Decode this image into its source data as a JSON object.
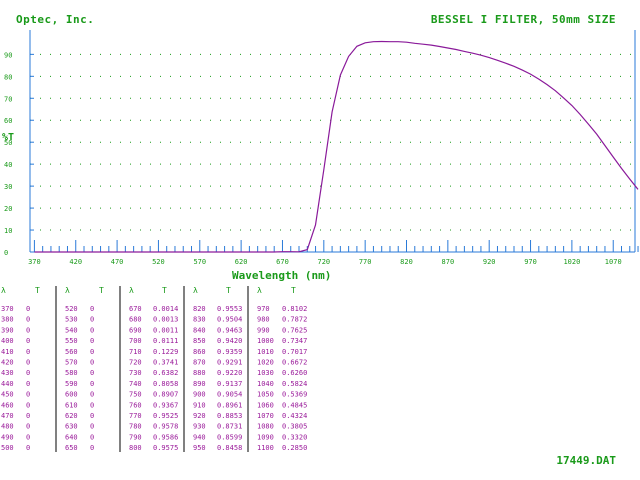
{
  "header": {
    "company": "Optec, Inc.",
    "title": "BESSEL I FILTER, 50mm SIZE"
  },
  "footer": {
    "filename": "17449.DAT"
  },
  "colors": {
    "green": "#1a9a1a",
    "curve": "#8a1a9a",
    "axis": "#2a7ad8",
    "value": "#9a1a9a",
    "grid": "#1a9a1a"
  },
  "chart_data": {
    "type": "line",
    "title": "BESSEL I FILTER, 50mm SIZE",
    "xlabel": "Wavelength (nm)",
    "ylabel": "%T",
    "xlim": [
      370,
      1100
    ],
    "ylim": [
      0,
      100
    ],
    "xticks": [
      370,
      420,
      470,
      520,
      570,
      620,
      670,
      720,
      770,
      820,
      870,
      920,
      970,
      1020,
      1070
    ],
    "yticks": [
      0,
      10,
      20,
      30,
      40,
      50,
      60,
      70,
      80,
      90
    ],
    "grid": true,
    "series": [
      {
        "x": [
          370,
          380,
          390,
          400,
          410,
          420,
          430,
          440,
          450,
          460,
          470,
          480,
          490,
          500,
          510,
          520,
          530,
          540,
          550,
          560,
          570,
          580,
          590,
          600,
          610,
          620,
          630,
          640,
          650,
          660,
          670,
          680,
          690,
          700,
          710,
          720,
          730,
          740,
          750,
          760,
          770,
          780,
          790,
          800,
          810,
          820,
          830,
          840,
          850,
          860,
          870,
          880,
          890,
          900,
          910,
          920,
          930,
          940,
          950,
          960,
          970,
          980,
          990,
          1000,
          1010,
          1020,
          1030,
          1040,
          1050,
          1060,
          1070,
          1080,
          1090,
          1100
        ],
        "y": [
          0,
          0,
          0,
          0,
          0,
          0,
          0,
          0,
          0,
          0,
          0,
          0,
          0,
          0,
          0,
          0,
          0,
          0,
          0,
          0,
          0,
          0,
          0,
          0,
          0,
          0,
          0,
          0,
          0,
          0,
          0.0014,
          0.0013,
          0.0011,
          0.0111,
          0.1229,
          0.3741,
          0.6382,
          0.8058,
          0.8907,
          0.9367,
          0.9525,
          0.9578,
          0.9586,
          0.9575,
          0.9578,
          0.9553,
          0.9504,
          0.9463,
          0.942,
          0.9359,
          0.9291,
          0.922,
          0.9137,
          0.9054,
          0.8961,
          0.8853,
          0.8731,
          0.8599,
          0.8458,
          0.8284,
          0.8102,
          0.7872,
          0.7625,
          0.7347,
          0.7017,
          0.6672,
          0.626,
          0.5824,
          0.5369,
          0.4845,
          0.4324,
          0.3805,
          0.332,
          0.285
        ]
      }
    ]
  },
  "table": {
    "headers": [
      "λ",
      "T"
    ]
  }
}
